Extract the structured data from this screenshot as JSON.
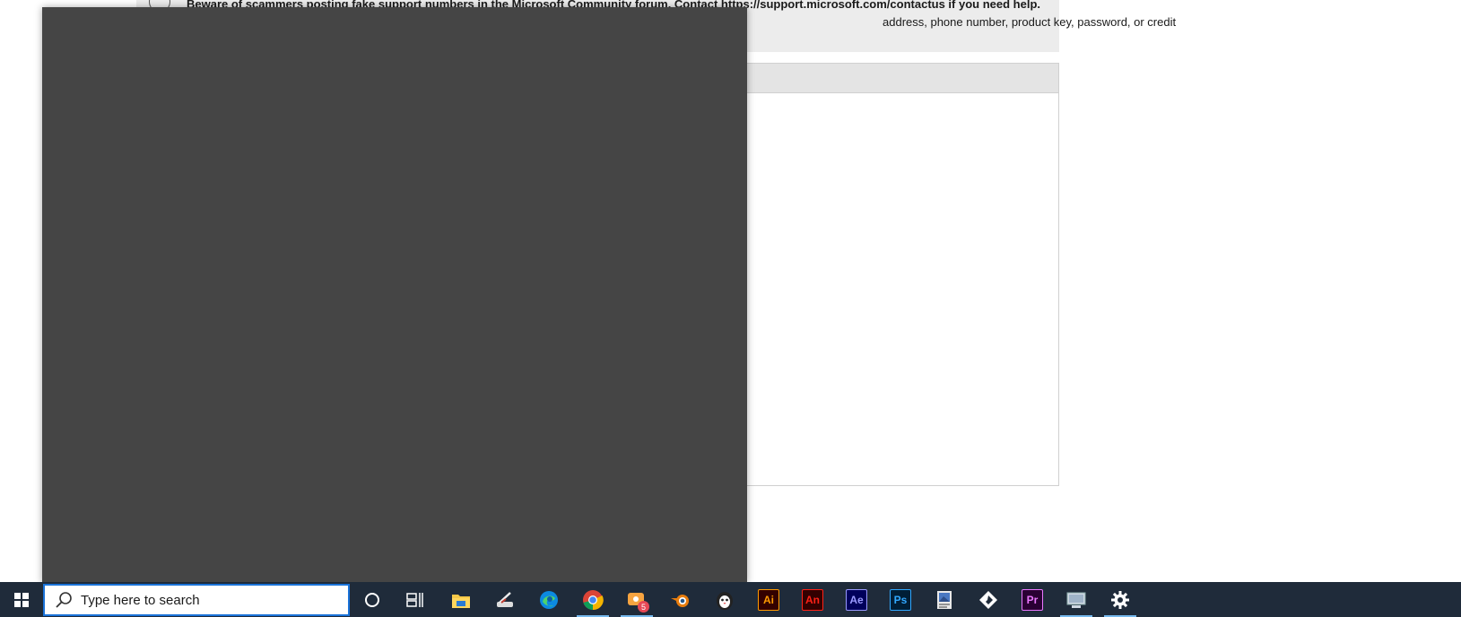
{
  "notice": {
    "line1": "Beware of scammers posting fake support numbers in the Microsoft Community forum. Contact https://support.microsoft.com/contactus if you need help.",
    "line2": "address, phone number, product key, password, or credit"
  },
  "taskbar": {
    "search_placeholder": "Type here to search",
    "apps": [
      {
        "name": "Cortana",
        "icon": "circle-icon"
      },
      {
        "name": "Task View",
        "icon": "task-view-icon"
      },
      {
        "name": "File Explorer",
        "icon": "folder-icon"
      },
      {
        "name": "Sketch App",
        "icon": "pen-icon"
      },
      {
        "name": "Microsoft Edge",
        "icon": "edge-icon"
      },
      {
        "name": "Google Chrome",
        "icon": "chrome-icon"
      },
      {
        "name": "Notifications App",
        "icon": "chat-icon",
        "badge": "5"
      },
      {
        "name": "Blender",
        "icon": "blender-icon"
      },
      {
        "name": "Animal App",
        "icon": "penguin-icon"
      },
      {
        "name": "Illustrator",
        "icon": "illustrator-icon",
        "label": "Ai",
        "color": "#ff9a00"
      },
      {
        "name": "Animate",
        "icon": "animate-icon",
        "label": "An",
        "color": "#ff2116"
      },
      {
        "name": "After Effects",
        "icon": "after-effects-icon",
        "label": "Ae",
        "color": "#9999ff"
      },
      {
        "name": "Photoshop",
        "icon": "photoshop-icon",
        "label": "Ps",
        "color": "#31a8ff"
      },
      {
        "name": "Image Viewer",
        "icon": "image-app-icon"
      },
      {
        "name": "Inkscape",
        "icon": "diamond-icon"
      },
      {
        "name": "Premiere Pro",
        "icon": "premiere-icon",
        "label": "Pr",
        "color": "#ea77ff"
      },
      {
        "name": "Network App",
        "icon": "network-icon"
      },
      {
        "name": "Settings",
        "icon": "gear-icon"
      }
    ]
  },
  "colors": {
    "taskbar_bg": "#1f2b3a",
    "flyout_bg": "#454545",
    "search_border": "#1a73d9"
  }
}
